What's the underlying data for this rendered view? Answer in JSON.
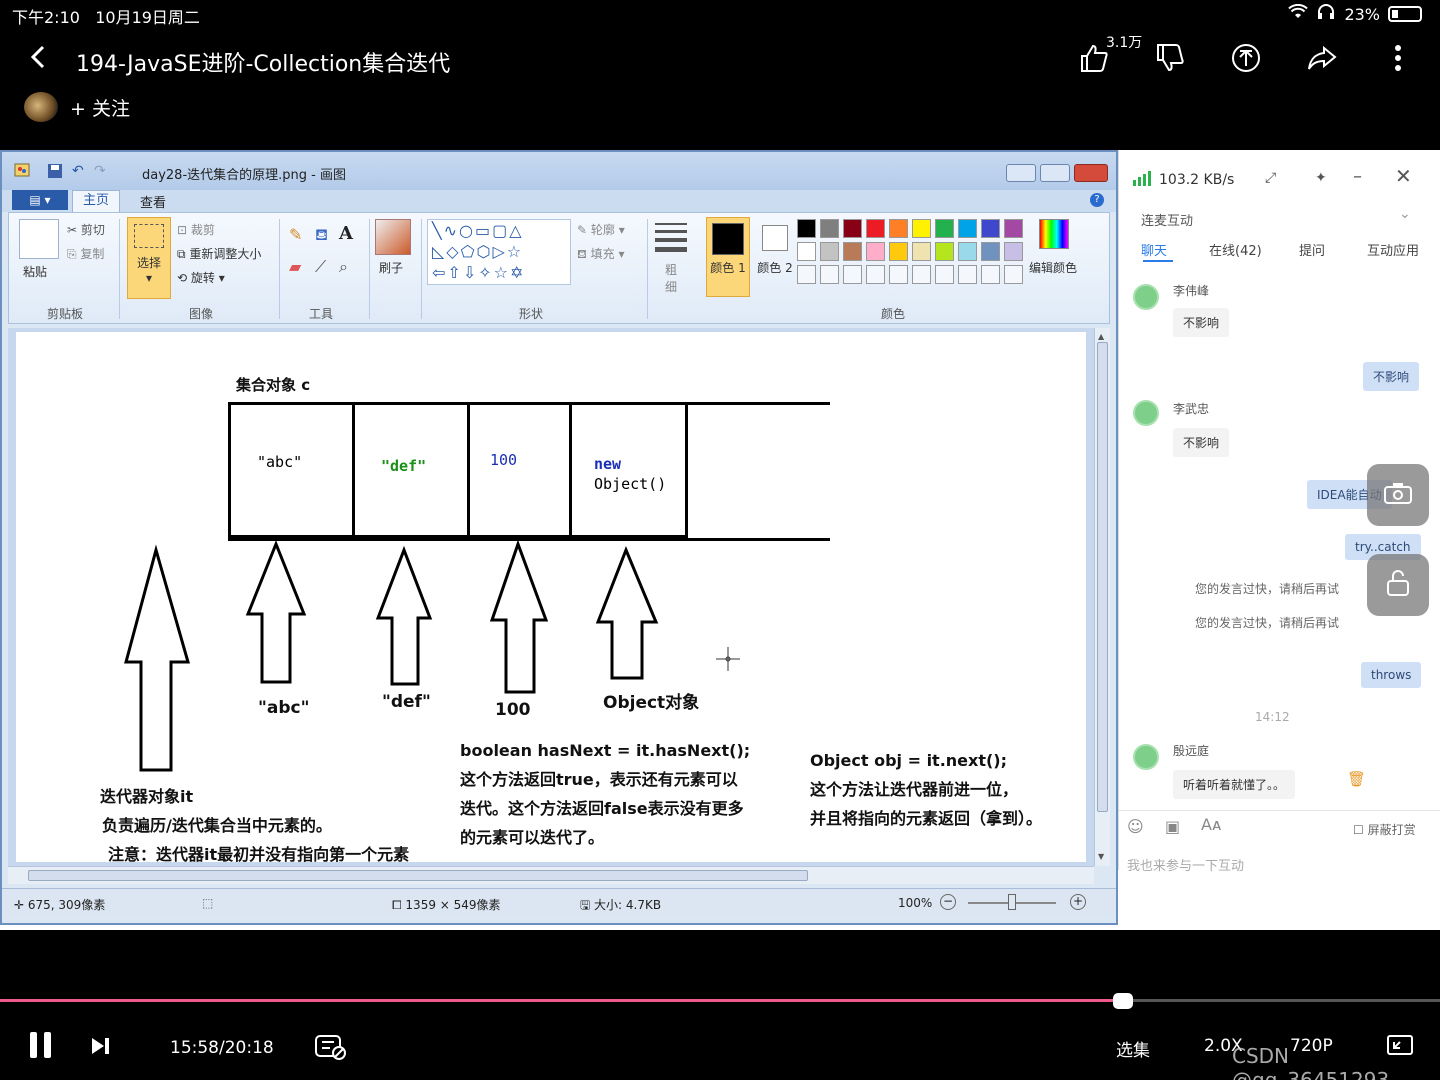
{
  "status": {
    "time": "下午2:10",
    "date": "10月19日周二",
    "battery": "23%"
  },
  "header": {
    "title": "194-JavaSE进阶-Collection集合迭代",
    "like_count": "3.1万",
    "follow_label": "+ 关注"
  },
  "paint": {
    "window_title": "day28-迭代集合的原理.png - 画图",
    "tabs": [
      "主页",
      "查看"
    ],
    "clipboard": {
      "paste": "粘贴",
      "cut": "剪切",
      "copy": "复制",
      "group": "剪贴板"
    },
    "image": {
      "select": "选择",
      "crop": "裁剪",
      "resize": "重新调整大小",
      "rotate": "旋转",
      "group": "图像"
    },
    "tools_group": "工具",
    "brush": "刷子",
    "shapes": {
      "outline": "轮廓",
      "fill": "填充",
      "group": "形状"
    },
    "size": "粗细",
    "color1": "颜色 1",
    "color2": "颜色 2",
    "edit_colors": "编辑颜色",
    "colors_group": "颜色",
    "palette": [
      "#000000",
      "#7f7f7f",
      "#880015",
      "#ed1c24",
      "#ff7f27",
      "#fff200",
      "#22b14c",
      "#00a2e8",
      "#3f48cc",
      "#a349a4",
      "#ffffff",
      "#c3c3c3",
      "#b97a57",
      "#ffaec9",
      "#ffc90e",
      "#efe4b0",
      "#b5e61d",
      "#99d9ea",
      "#7092be",
      "#c8bfe7"
    ],
    "status": {
      "pos": "675, 309像素",
      "dims": "1359 × 549像素",
      "filesize": "大小: 4.7KB",
      "zoom": "100%"
    }
  },
  "diagram": {
    "collection_label": "集合对象 c",
    "cells": [
      {
        "text": "\"abc\"",
        "color": "#000000"
      },
      {
        "text": "\"def\"",
        "color": "#1a8f1a"
      },
      {
        "text": "100",
        "color": "#1a2fb5"
      },
      {
        "text": "new",
        "color": "#1a2fb5"
      },
      {
        "text": "Object()",
        "color": "#000000"
      }
    ],
    "arrow_labels": [
      "\"abc\"",
      "\"def\"",
      "100",
      "Object对象"
    ],
    "iterator_title": "迭代器对象it",
    "iterator_desc1": "负责遍历/迭代集合当中元素的。",
    "iterator_desc2": "注意：迭代器it最初并没有指向第一个元素",
    "hasnext_lines": [
      "boolean hasNext = it.hasNext();",
      "这个方法返回true，表示还有元素可以",
      "迭代。这个方法返回false表示没有更多",
      "的元素可以迭代了。"
    ],
    "next_lines": [
      "Object obj = it.next();",
      "这个方法让迭代器前进一位，",
      "并且将指向的元素返回（拿到）。"
    ]
  },
  "chat": {
    "speed": "103.2 KB/s",
    "section": "连麦互动",
    "tabs": [
      "聊天",
      "在线(42)",
      "提问",
      "互动应用"
    ],
    "messages": [
      {
        "type": "user",
        "name": "李伟峰",
        "text": "不影响"
      },
      {
        "type": "me",
        "text": "不影响"
      },
      {
        "type": "user",
        "name": "李武忠",
        "text": "不影响"
      },
      {
        "type": "me",
        "text": "IDEA能自动"
      },
      {
        "type": "me",
        "text": "try..catch"
      },
      {
        "type": "sys",
        "text": "您的发言过快，请稍后再试"
      },
      {
        "type": "sys",
        "text": "您的发言过快，请稍后再试"
      },
      {
        "type": "me",
        "text": "throws"
      },
      {
        "type": "time",
        "text": "14:12"
      },
      {
        "type": "user",
        "name": "殷远庭",
        "text": "听着听着就懂了。。"
      }
    ],
    "block_label": "屏蔽打赏",
    "input_placeholder": "我也来参与一下互动"
  },
  "player": {
    "progress": 0.78,
    "time": "15:58/20:18",
    "episodes": "选集",
    "speed": "2.0X",
    "quality": "720P",
    "watermark": "CSDN @qq_36451293"
  }
}
